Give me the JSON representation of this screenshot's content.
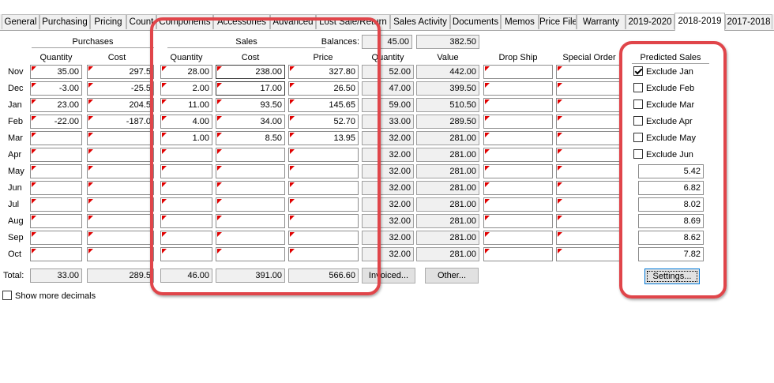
{
  "tabs": [
    {
      "label": "General"
    },
    {
      "label": "Purchasing"
    },
    {
      "label": "Pricing"
    },
    {
      "label": "Count"
    },
    {
      "label": "Components"
    },
    {
      "label": "Accessories"
    },
    {
      "label": "Advanced"
    },
    {
      "label": "Lost Sale/Return"
    },
    {
      "label": "Sales Activity"
    },
    {
      "label": "Documents"
    },
    {
      "label": "Memos"
    },
    {
      "label": "Price File"
    },
    {
      "label": "Warranty"
    },
    {
      "label": "2019-2020"
    },
    {
      "label": "2018-2019",
      "active": true
    },
    {
      "label": "2017-2018"
    }
  ],
  "groups": {
    "purchases": "Purchases",
    "sales": "Sales",
    "balances": "Balances:",
    "predicted_sales": "Predicted Sales"
  },
  "balances_values": [
    "45.00",
    "382.50"
  ],
  "columns": {
    "p_qty": "Quantity",
    "p_cost": "Cost",
    "s_qty": "Quantity",
    "s_cost": "Cost",
    "s_price": "Price",
    "b_qty": "Quantity",
    "b_value": "Value",
    "drop_ship": "Drop Ship",
    "special_order": "Special Order"
  },
  "months": [
    "Nov",
    "Dec",
    "Jan",
    "Feb",
    "Mar",
    "Apr",
    "May",
    "Jun",
    "Jul",
    "Aug",
    "Sep",
    "Oct"
  ],
  "grid": {
    "p_qty": [
      "35.00",
      "-3.00",
      "23.00",
      "-22.00",
      "",
      "",
      "",
      "",
      "",
      "",
      "",
      ""
    ],
    "p_cost": [
      "297.5",
      "-25.5",
      "204.5",
      "-187.0",
      "",
      "",
      "",
      "",
      "",
      "",
      "",
      ""
    ],
    "s_qty": [
      "28.00",
      "2.00",
      "11.00",
      "4.00",
      "1.00",
      "",
      "",
      "",
      "",
      "",
      "",
      ""
    ],
    "s_cost": [
      "238.00",
      "17.00",
      "93.50",
      "34.00",
      "8.50",
      "",
      "",
      "",
      "",
      "",
      "",
      ""
    ],
    "s_price": [
      "327.80",
      "26.50",
      "145.65",
      "52.70",
      "13.95",
      "",
      "",
      "",
      "",
      "",
      "",
      ""
    ],
    "b_qty": [
      "52.00",
      "47.00",
      "59.00",
      "33.00",
      "32.00",
      "32.00",
      "32.00",
      "32.00",
      "32.00",
      "32.00",
      "32.00",
      "32.00"
    ],
    "b_value": [
      "442.00",
      "399.50",
      "510.50",
      "289.50",
      "281.00",
      "281.00",
      "281.00",
      "281.00",
      "281.00",
      "281.00",
      "281.00",
      "281.00"
    ],
    "drop_ship": [
      "",
      "",
      "",
      "",
      "",
      "",
      "",
      "",
      "",
      "",
      "",
      ""
    ],
    "special_order": [
      "",
      "",
      "",
      "",
      "",
      "",
      "",
      "",
      "",
      "",
      "",
      ""
    ]
  },
  "exclusions": [
    {
      "label": "Exclude Jan",
      "checked": true
    },
    {
      "label": "Exclude Feb",
      "checked": false
    },
    {
      "label": "Exclude Mar",
      "checked": false
    },
    {
      "label": "Exclude Apr",
      "checked": false
    },
    {
      "label": "Exclude May",
      "checked": false
    },
    {
      "label": "Exclude Jun",
      "checked": false
    }
  ],
  "predicted_values": [
    "5.42",
    "6.82",
    "8.02",
    "8.69",
    "8.62",
    "7.82"
  ],
  "totals": {
    "label": "Total:",
    "p_qty": "33.00",
    "p_cost": "289.5",
    "s_qty": "46.00",
    "s_cost": "391.00",
    "s_price": "566.60"
  },
  "buttons": {
    "invoiced": "Invoiced...",
    "other": "Other...",
    "settings": "Settings..."
  },
  "show_more_decimals": {
    "label": "Show more decimals",
    "checked": false
  },
  "colors": {
    "highlight": "#e0454a",
    "flag": "#e00000"
  }
}
